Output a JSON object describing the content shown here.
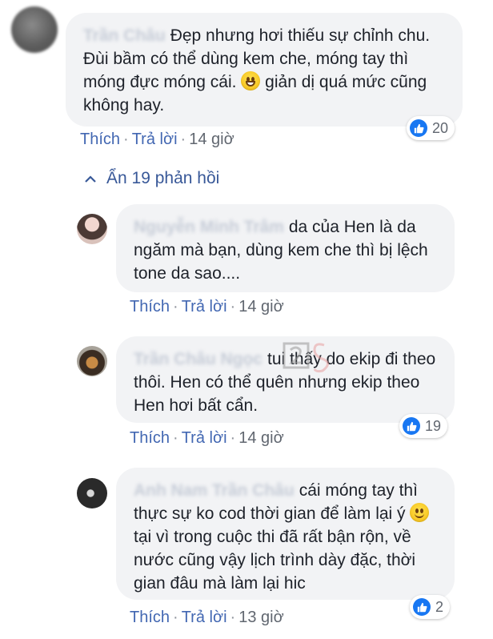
{
  "comment": {
    "author": "Trần Châu",
    "text_parts": [
      "Đẹp nhưng hơi thiếu sự chỉnh chu. Đùi bầm có thể dùng kem che, móng tay thì móng đực móng cái.",
      "giản dị quá mức cũng không hay."
    ],
    "emoji": "grin-emoji",
    "likes": "20",
    "like_label": "Thích",
    "reply_label": "Trả lời",
    "time": "14 giờ"
  },
  "toggle": {
    "label": "Ẩn 19 phản hồi"
  },
  "replies": [
    {
      "author": "Nguyễn Minh Trâm",
      "text": "da của Hen là da ngăm mà bạn, dùng kem che thì bị lệch tone da sao....",
      "like_label": "Thích",
      "reply_label": "Trả lời",
      "time": "14 giờ"
    },
    {
      "author": "Trần Châu Ngọc",
      "text": "tui thấy do ekip đi theo thôi. Hen có thể quên nhưng ekip theo Hen hơi bất cẩn.",
      "likes": "19",
      "like_label": "Thích",
      "reply_label": "Trả lời",
      "time": "14 giờ"
    },
    {
      "author": "Anh Nam Trần Châu",
      "text_parts": [
        "cái móng tay thì thực sự ko cod thời gian để làm lại ý",
        "tại vì trong cuộc thi đã rất bận rộn, về nước cũng vậy lịch trình dày đặc, thời gian đâu mà làm lại hic"
      ],
      "emoji": "smile-emoji",
      "likes": "2",
      "like_label": "Thích",
      "reply_label": "Trả lời",
      "time": "13 giờ"
    }
  ],
  "icons": {
    "like": "thumbs-up-icon",
    "collapse": "chevron-up-icon"
  },
  "colors": {
    "link": "#4267b2",
    "bubble": "#f2f3f5",
    "like_blue": "#1877f2"
  }
}
